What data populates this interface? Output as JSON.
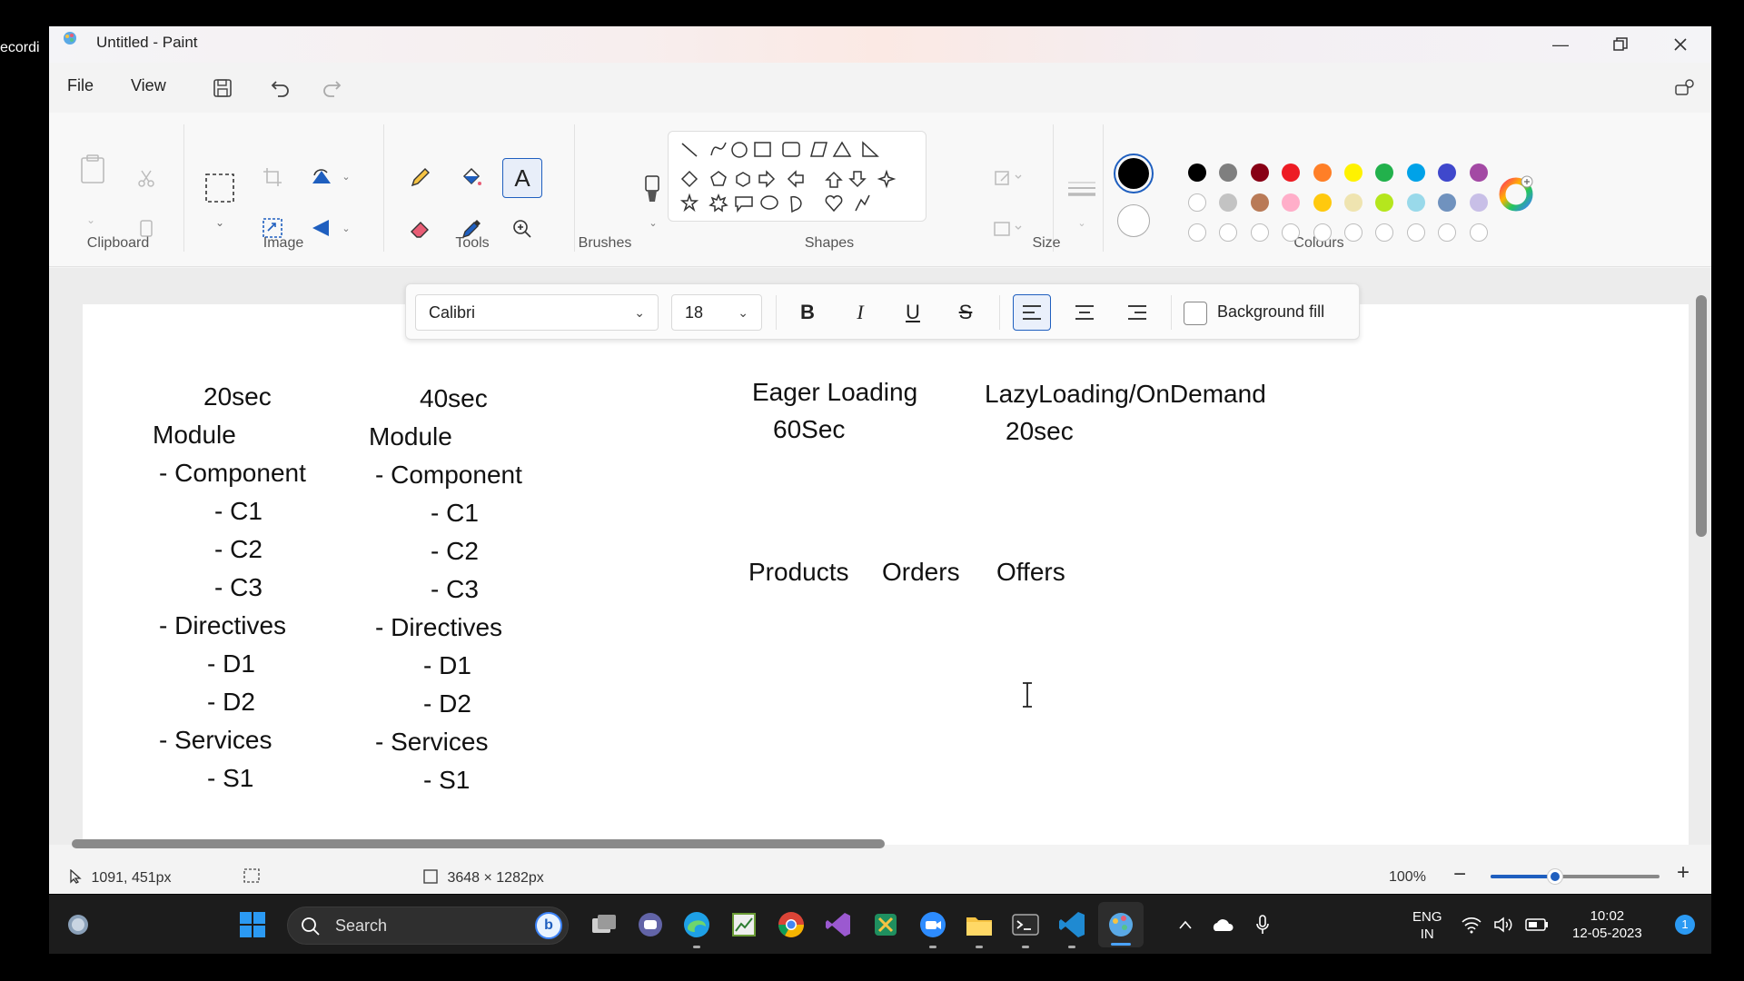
{
  "recording_label": "ecordi",
  "window": {
    "title": "Untitled - Paint",
    "controls": {
      "minimize": "minimize-icon",
      "restore": "restore-icon",
      "close": "close-icon"
    }
  },
  "menu": {
    "file": "File",
    "view": "View"
  },
  "ribbon": {
    "groups": {
      "clipboard": "Clipboard",
      "image": "Image",
      "tools": "Tools",
      "brushes": "Brushes",
      "shapes": "Shapes",
      "size": "Size",
      "colours": "Colours"
    }
  },
  "colors": {
    "primary": "#000000",
    "secondary": "#ffffff",
    "palette_row1": [
      "#000000",
      "#7f7f7f",
      "#880015",
      "#ed1c24",
      "#ff7f27",
      "#fff200",
      "#22b14c",
      "#00a2e8",
      "#3f48cc",
      "#a349a4"
    ],
    "palette_row2": [
      "#ffffff",
      "#c3c3c3",
      "#b97a57",
      "#ffaec9",
      "#ffc90e",
      "#efe4b0",
      "#b5e61d",
      "#99d9ea",
      "#7092be",
      "#c8bfe7"
    ]
  },
  "text_toolbar": {
    "font": "Calibri",
    "size": "18",
    "bold": "B",
    "italic": "I",
    "underline": "U",
    "strikethrough": "S",
    "background_fill": "Background fill"
  },
  "canvas_text": {
    "col1": [
      "20sec",
      "Module",
      "- Component",
      "- C1",
      "- C2",
      "- C3",
      "- Directives",
      "- D1",
      "- D2",
      "- Services",
      "- S1"
    ],
    "col2": [
      "40sec",
      "Module",
      "- Component",
      "- C1",
      "- C2",
      "- C3",
      "- Directives",
      "- D1",
      "- D2",
      "- Services",
      "- S1"
    ],
    "eager_title": "Eager Loading",
    "eager_time": "60Sec",
    "lazy_title": "LazyLoading/OnDemand",
    "lazy_time": "20sec",
    "products": "Products",
    "orders": "Orders",
    "offers": "Offers"
  },
  "status": {
    "cursor": "1091, 451px",
    "canvas_size": "3648 × 1282px",
    "zoom": "100%",
    "zoom_minus": "−",
    "zoom_plus": "+"
  },
  "taskbar": {
    "search_placeholder": "Search",
    "lang_line1": "ENG",
    "lang_line2": "IN",
    "time": "10:02",
    "date": "12-05-2023",
    "notification_count": "1"
  }
}
